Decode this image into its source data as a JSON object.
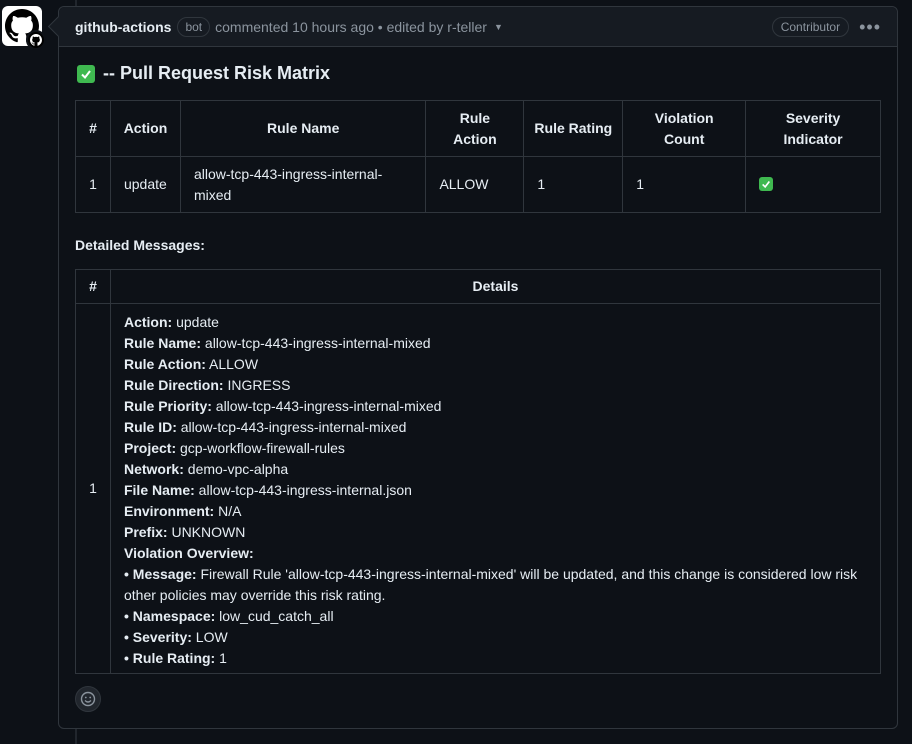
{
  "comment": {
    "author": "github-actions",
    "bot_label": "bot",
    "meta": "commented 10 hours ago • edited by r-teller",
    "role": "Contributor",
    "more_menu": "•••"
  },
  "title": "-- Pull Request Risk Matrix",
  "risk_table": {
    "headers": [
      "#",
      "Action",
      "Rule Name",
      "Rule Action",
      "Rule Rating",
      "Violation Count",
      "Severity Indicator"
    ],
    "rows": [
      {
        "num": "1",
        "action": "update",
        "rule_name": "allow-tcp-443-ingress-internal-mixed",
        "rule_action": "ALLOW",
        "rule_rating": "1",
        "violation_count": "1",
        "severity_icon": "check-icon"
      }
    ]
  },
  "detailed_label": "Detailed Messages:",
  "details_table": {
    "headers": [
      "#",
      "Details"
    ],
    "row_num": "1",
    "lines": [
      {
        "label": "Action:",
        "value": " update"
      },
      {
        "label": "Rule Name:",
        "value": " allow-tcp-443-ingress-internal-mixed"
      },
      {
        "label": "Rule Action:",
        "value": " ALLOW"
      },
      {
        "label": "Rule Direction:",
        "value": " INGRESS"
      },
      {
        "label": "Rule Priority:",
        "value": " allow-tcp-443-ingress-internal-mixed"
      },
      {
        "label": "Rule ID:",
        "value": " allow-tcp-443-ingress-internal-mixed"
      },
      {
        "label": "Project:",
        "value": " gcp-workflow-firewall-rules"
      },
      {
        "label": "Network:",
        "value": " demo-vpc-alpha"
      },
      {
        "label": "File Name:",
        "value": " allow-tcp-443-ingress-internal.json"
      },
      {
        "label": "Environment:",
        "value": " N/A"
      },
      {
        "label": "Prefix:",
        "value": " UNKNOWN"
      },
      {
        "label": "Violation Overview:",
        "value": ""
      },
      {
        "label": "• Message:",
        "value": " Firewall Rule 'allow-tcp-443-ingress-internal-mixed' will be updated, and this change is considered low risk"
      },
      {
        "label": "",
        "value": "other policies may override this risk rating."
      },
      {
        "label": "• Namespace:",
        "value": " low_cud_catch_all"
      },
      {
        "label": "• Severity:",
        "value": " LOW"
      },
      {
        "label": "• Rule Rating:",
        "value": " 1"
      }
    ]
  },
  "colors": {
    "background": "#0d1117",
    "border": "#30363d",
    "check": "#3fb950",
    "muted": "#8b949e"
  },
  "icons": {
    "avatar": "github-logo-icon",
    "badge": "github-logo-icon",
    "reaction": "smiley-icon",
    "caret": "caret-down-icon"
  }
}
